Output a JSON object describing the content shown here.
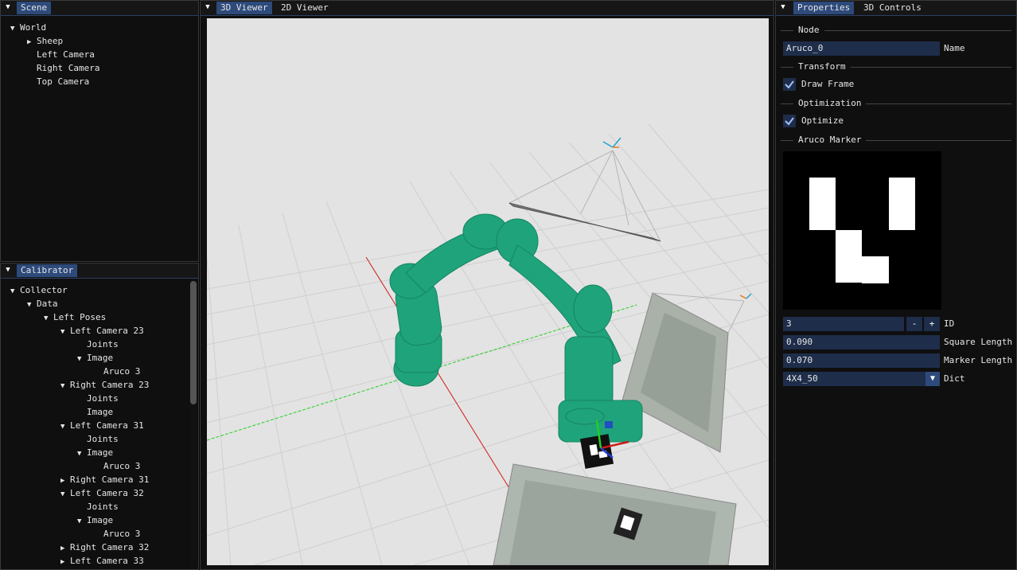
{
  "scene": {
    "tab": "Scene",
    "tree": [
      {
        "label": "World",
        "indent": 0,
        "arrow": "down"
      },
      {
        "label": "Sheep",
        "indent": 1,
        "arrow": "right"
      },
      {
        "label": "Left Camera",
        "indent": 1,
        "arrow": "none"
      },
      {
        "label": "Right Camera",
        "indent": 1,
        "arrow": "none"
      },
      {
        "label": "Top Camera",
        "indent": 1,
        "arrow": "none"
      }
    ]
  },
  "calibrator": {
    "tab": "Calibrator",
    "tree": [
      {
        "label": "Collector",
        "indent": 0,
        "arrow": "down"
      },
      {
        "label": "Data",
        "indent": 1,
        "arrow": "down"
      },
      {
        "label": "Left Poses",
        "indent": 2,
        "arrow": "down"
      },
      {
        "label": "Left Camera 23",
        "indent": 3,
        "arrow": "down"
      },
      {
        "label": "Joints",
        "indent": 4,
        "arrow": "none"
      },
      {
        "label": "Image",
        "indent": 4,
        "arrow": "down"
      },
      {
        "label": "Aruco 3",
        "indent": 5,
        "arrow": "none"
      },
      {
        "label": "Right Camera 23",
        "indent": 3,
        "arrow": "down"
      },
      {
        "label": "Joints",
        "indent": 4,
        "arrow": "none"
      },
      {
        "label": "Image",
        "indent": 4,
        "arrow": "none"
      },
      {
        "label": "Left Camera 31",
        "indent": 3,
        "arrow": "down"
      },
      {
        "label": "Joints",
        "indent": 4,
        "arrow": "none"
      },
      {
        "label": "Image",
        "indent": 4,
        "arrow": "down"
      },
      {
        "label": "Aruco 3",
        "indent": 5,
        "arrow": "none"
      },
      {
        "label": "Right Camera 31",
        "indent": 3,
        "arrow": "right"
      },
      {
        "label": "Left Camera 32",
        "indent": 3,
        "arrow": "down"
      },
      {
        "label": "Joints",
        "indent": 4,
        "arrow": "none"
      },
      {
        "label": "Image",
        "indent": 4,
        "arrow": "down"
      },
      {
        "label": "Aruco 3",
        "indent": 5,
        "arrow": "none"
      },
      {
        "label": "Right Camera 32",
        "indent": 3,
        "arrow": "right"
      },
      {
        "label": "Left Camera 33",
        "indent": 3,
        "arrow": "right"
      }
    ]
  },
  "viewer": {
    "tabs": [
      "3D Viewer",
      "2D Viewer"
    ]
  },
  "properties": {
    "tabs": [
      "Properties",
      "3D Controls"
    ],
    "section_node": "Node",
    "name_value": "Aruco_0",
    "name_label": "Name",
    "section_transform": "Transform",
    "draw_frame_label": "Draw Frame",
    "section_optimization": "Optimization",
    "optimize_label": "Optimize",
    "section_aruco": "Aruco Marker",
    "id_value": "3",
    "id_minus": "-",
    "id_plus": "+",
    "id_label": "ID",
    "square_length_value": "0.090",
    "square_length_label": "Square Length",
    "marker_length_value": "0.070",
    "marker_length_label": "Marker Length",
    "dict_value": "4X4_50",
    "dict_label": "Dict"
  },
  "colors": {
    "accent": "#2d4a7a",
    "field": "#1e2d4a",
    "robot": "#1fa37a",
    "grid_x": "#d01818",
    "grid_y": "#22d022"
  }
}
